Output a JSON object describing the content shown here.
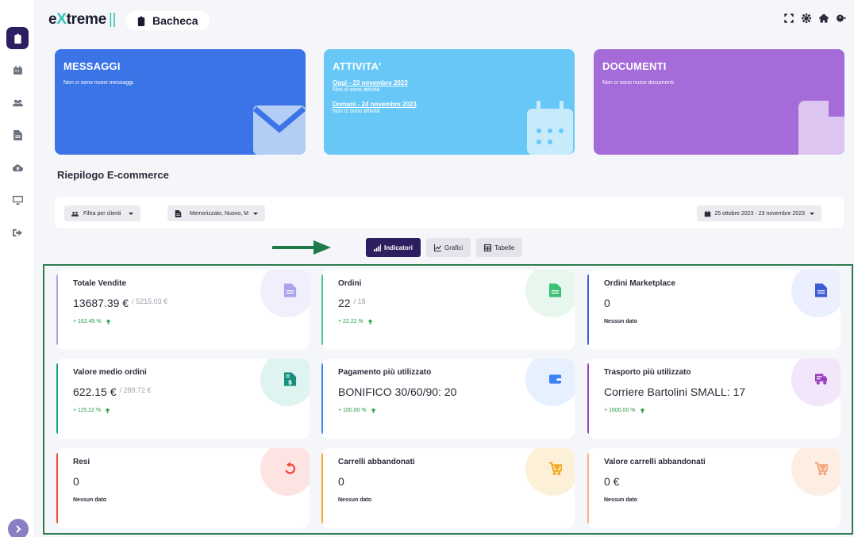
{
  "app": {
    "logo_e": "e",
    "logo_x": "X",
    "logo_rest": "treme",
    "logo_bars": "||",
    "breadcrumb": "Bacheca"
  },
  "sidebar": {
    "items": [
      {
        "icon": "clipboard-icon",
        "active": true
      },
      {
        "icon": "calendar-icon",
        "active": false
      },
      {
        "icon": "users-icon",
        "active": false
      },
      {
        "icon": "document-icon",
        "active": false
      },
      {
        "icon": "cloud-upload-icon",
        "active": false
      },
      {
        "icon": "monitor-icon",
        "active": false
      },
      {
        "icon": "sign-out-icon",
        "active": false
      }
    ]
  },
  "hero": {
    "messages": {
      "title": "MESSAGGI",
      "text": "Non ci sono nuovi messaggi."
    },
    "activities": {
      "title": "ATTIVITA'",
      "today_link": "Oggi - 23 novembre 2023",
      "today_text": "Non ci sono attività",
      "tomorrow_link": "Domani - 24 novembre 2023",
      "tomorrow_text": "Non ci sono attività"
    },
    "documents": {
      "title": "DOCUMENTI",
      "text": "Non ci sono nuovi documenti"
    }
  },
  "section_title": "Riepilogo E-commerce",
  "filters": {
    "clients": "Filtra per clienti",
    "status": "Memorizzato, Nuovo, M",
    "date_range": "25 ottobre 2023 - 23 novembre 2023"
  },
  "view_tabs": {
    "indicators": "Indicatori",
    "charts": "Grafici",
    "tables": "Tabelle"
  },
  "kpis": [
    {
      "title": "Totale Vendite",
      "value": "13687.39 €",
      "previous": "/ 5215.03 €",
      "delta": "+ 162.45 %",
      "accent": "#a9a4e6",
      "circle": "#f0effb",
      "icon": "document-icon",
      "icon_color": "#aaa3ee"
    },
    {
      "title": "Ordini",
      "value": "22",
      "previous": "/ 18",
      "delta": "+ 22.22 %",
      "accent": "#48c28a",
      "circle": "#e7f7ee",
      "icon": "document-icon",
      "icon_color": "#3dbf76"
    },
    {
      "title": "Ordini Marketplace",
      "value": "0",
      "previous": "",
      "nodata": "Nessun dato",
      "accent": "#3e5cd8",
      "circle": "#eceffd",
      "icon": "document-icon",
      "icon_color": "#3e5cd8"
    },
    {
      "title": "Valore medio ordini",
      "value": "622.15 €",
      "previous": "/ 289.72 €",
      "delta": "+ 115.22 %",
      "accent": "#1aa28a",
      "circle": "#dff3f0",
      "icon": "invoice-dollar-icon",
      "icon_color": "#148f7d"
    },
    {
      "title": "Pagamento più utilizzato",
      "value": "BONIFICO 30/60/90: 20",
      "previous": "",
      "delta": "+ 100.00 %",
      "accent": "#3b82f6",
      "circle": "#e6f0fe",
      "icon": "wallet-icon",
      "icon_color": "#3b82f6"
    },
    {
      "title": "Trasporto più utilizzato",
      "value": "Corriere Bartolini SMALL: 17",
      "previous": "",
      "delta": "+ 1600.00 %",
      "accent": "#9b3fc2",
      "circle": "#f2e6fa",
      "icon": "truck-icon",
      "icon_color": "#9b3fc2"
    },
    {
      "title": "Resi",
      "value": "0",
      "previous": "",
      "nodata": "Nessun dato",
      "accent": "#ea4b3b",
      "circle": "#fde4e2",
      "icon": "undo-icon",
      "icon_color": "#ea4b3b"
    },
    {
      "title": "Carrelli abbandonati",
      "value": "0",
      "previous": "",
      "nodata": "Nessun dato",
      "accent": "#f2a821",
      "circle": "#fdf0d8",
      "icon": "cart-plus-icon",
      "icon_color": "#f2a821"
    },
    {
      "title": "Valore carrelli abbandonati",
      "value": "0 €",
      "previous": "",
      "nodata": "Nessun dato",
      "accent": "#f6b08a",
      "circle": "#fdeee4",
      "icon": "cart-plus-icon",
      "icon_color": "#f5a37a"
    }
  ]
}
